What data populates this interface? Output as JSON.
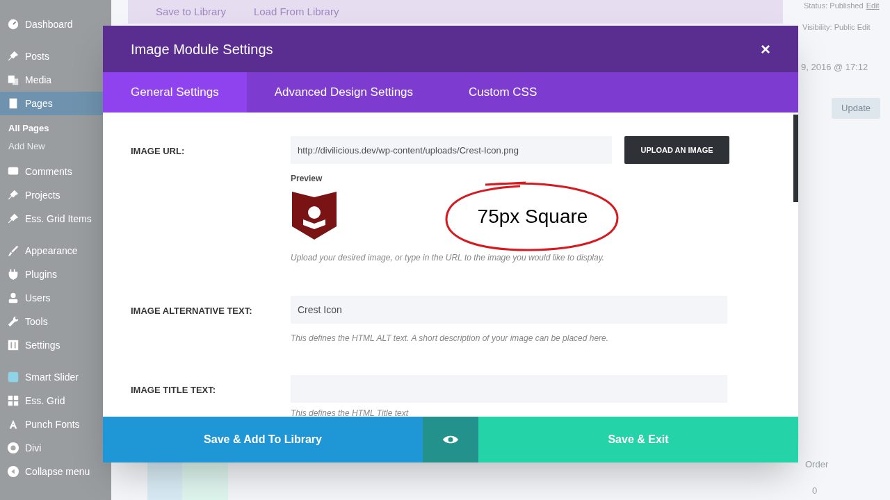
{
  "sidebar": {
    "items": [
      {
        "label": "Dashboard",
        "kind": "gauge",
        "selected": false
      },
      {
        "label": "Posts",
        "kind": "pin",
        "selected": false
      },
      {
        "label": "Media",
        "kind": "media",
        "selected": false
      },
      {
        "label": "Pages",
        "kind": "page",
        "selected": true,
        "children": [
          {
            "label": "All Pages",
            "selected": true
          },
          {
            "label": "Add New",
            "selected": false
          }
        ]
      },
      {
        "label": "Comments",
        "kind": "comment",
        "selected": false
      },
      {
        "label": "Projects",
        "kind": "pin",
        "selected": false
      },
      {
        "label": "Ess. Grid Items",
        "kind": "pin",
        "selected": false
      },
      {
        "label": "Appearance",
        "kind": "brush",
        "selected": false
      },
      {
        "label": "Plugins",
        "kind": "plug",
        "selected": false
      },
      {
        "label": "Users",
        "kind": "user",
        "selected": false
      },
      {
        "label": "Tools",
        "kind": "wrench",
        "selected": false
      },
      {
        "label": "Settings",
        "kind": "settings",
        "selected": false
      },
      {
        "label": "Smart Slider",
        "kind": "slider",
        "selected": false
      },
      {
        "label": "Ess. Grid",
        "kind": "grid",
        "selected": false
      },
      {
        "label": "Punch Fonts",
        "kind": "font",
        "selected": false
      },
      {
        "label": "Divi",
        "kind": "divi",
        "selected": false
      },
      {
        "label": "Collapse menu",
        "kind": "collapse",
        "selected": false
      }
    ]
  },
  "background": {
    "toolbar_buttons": [
      "Save to Library",
      "Load From Library"
    ],
    "status": "Status: Published",
    "status_link": "Edit",
    "visibility": "Visibility: Public Edit",
    "date": "9, 2016 @ 17:12",
    "update_button": "Update",
    "order_label": "Order",
    "order_value": "0"
  },
  "modal": {
    "title": "Image Module Settings",
    "close": "×",
    "tabs": [
      {
        "label": "General Settings",
        "selected": true
      },
      {
        "label": "Advanced Design Settings",
        "selected": false
      },
      {
        "label": "Custom CSS",
        "selected": false
      }
    ],
    "fields": [
      {
        "label": "IMAGE URL:",
        "value": "http://divilicious.dev/wp-content/uploads/Crest-Icon.png",
        "button": "UPLOAD AN IMAGE",
        "preview_label": "Preview",
        "help": "Upload your desired image, or type in the URL to the image you would like to display."
      },
      {
        "label": "IMAGE ALTERNATIVE TEXT:",
        "value": "Crest Icon",
        "help": "This defines the HTML ALT text. A short description of your image can be placed here."
      },
      {
        "label": "IMAGE TITLE TEXT:",
        "help": "This defines the HTML Title text"
      }
    ],
    "annotation": "75px Square",
    "footer": {
      "library_button": "Save & Add To Library",
      "exit_button": "Save & Exit"
    }
  }
}
